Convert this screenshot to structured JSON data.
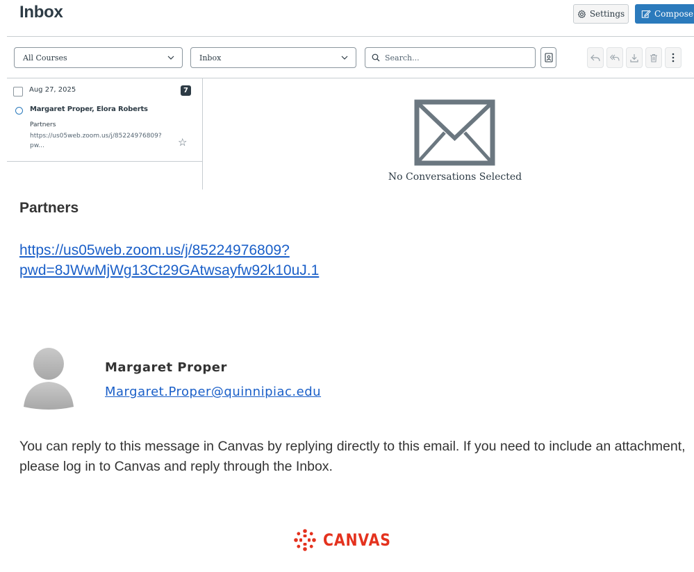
{
  "header": {
    "title": "Inbox",
    "settings_label": "Settings",
    "compose_label": "Compose"
  },
  "toolbar": {
    "course_filter": "All Courses",
    "mailbox_filter": "Inbox",
    "search_placeholder": "Search...",
    "actions": [
      "reply-icon",
      "reply-all-icon",
      "archive-icon",
      "trash-icon",
      "more-icon"
    ]
  },
  "conversation_list": [
    {
      "date": "Aug 27, 2025",
      "message_count": "7",
      "participants": "Margaret Proper, Elora Roberts",
      "subject": "Partners",
      "preview": "https://us05web.zoom.us/j/85224976809?pw...",
      "unread": true,
      "starred": false
    }
  ],
  "empty_state": {
    "message": "No Conversations Selected"
  },
  "email": {
    "subject": "Partners",
    "link": "https://us05web.zoom.us/j/85224976809?pwd=8JWwMjWg13Ct29GAtwsayfw92k10uJ.1",
    "link_line1": "https://us05web.zoom.us/j/85224976809?",
    "link_line2": "pwd=8JWwMjWg13Ct29GAtwsayfw92k10uJ.1",
    "sender_name": "Margaret Proper",
    "sender_email": "Margaret.Proper@quinnipiac.edu",
    "reply_note": "You can reply to this message in Canvas by replying directly to this email. If you need to include an attachment, please log in to Canvas and reply through the Inbox.",
    "footer_logo": "CANVAS"
  },
  "colors": {
    "primary": "#2b7abc",
    "text": "#2d3b45",
    "link": "#1a5fc8",
    "canvas_red": "#e4321e"
  }
}
